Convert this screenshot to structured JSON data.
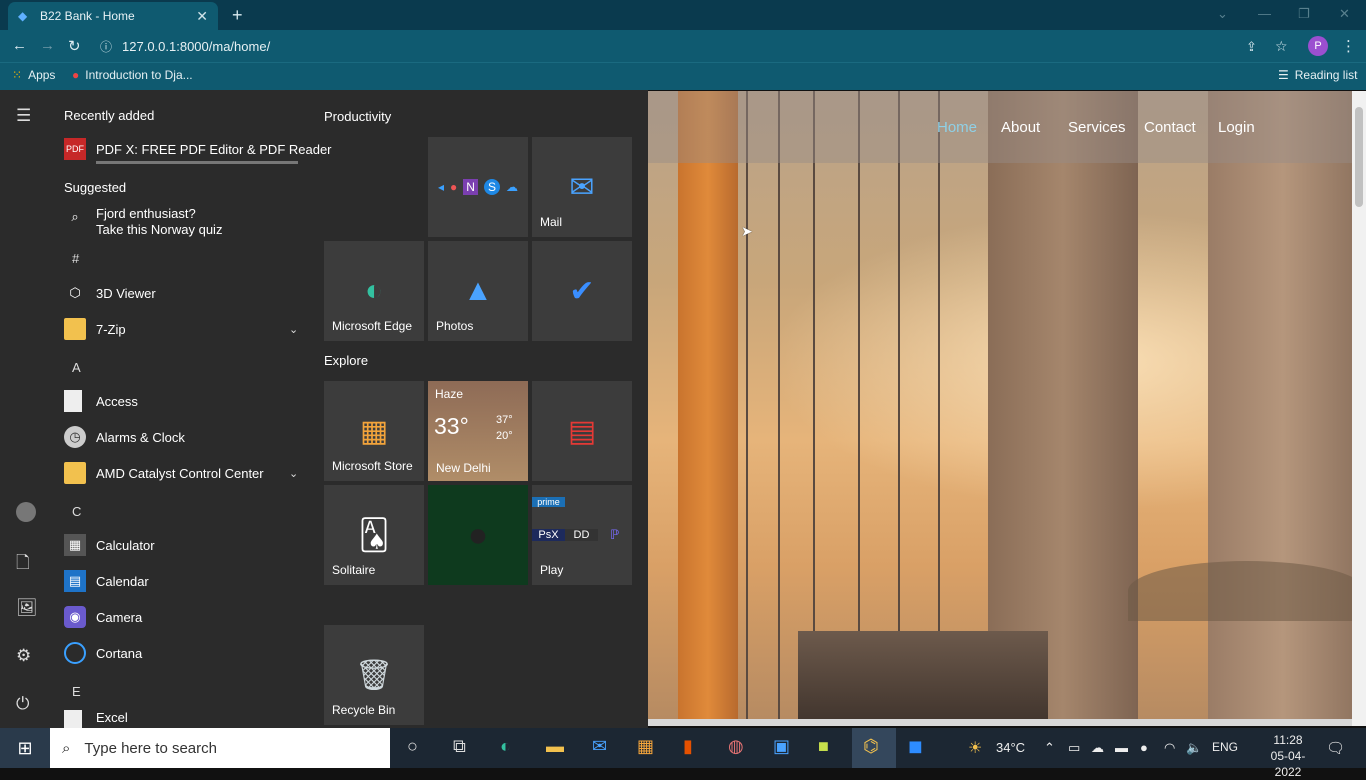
{
  "browser": {
    "tab_title": "B22 Bank - Home",
    "new_tab": "+",
    "url": "127.0.0.1:8000/ma/home/",
    "url_info_icon": "info-icon",
    "profile_initial": "P",
    "bookmarks": [
      {
        "label": "Apps",
        "icon": "apps-grid-icon"
      },
      {
        "label": "Introduction to Dja...",
        "icon": "site-favicon"
      }
    ],
    "reading_list": "Reading list"
  },
  "site": {
    "nav": [
      "Home",
      "About",
      "Services",
      "Contact",
      "Login"
    ],
    "active": "Home"
  },
  "start_menu": {
    "recently_added_heading": "Recently added",
    "recent": [
      {
        "label": "PDF X: FREE PDF Editor & PDF Reader"
      }
    ],
    "suggested_heading": "Suggested",
    "suggested": {
      "line1": "Fjord enthusiast?",
      "line2": "Take this Norway quiz"
    },
    "letters": [
      "#",
      "A",
      "C",
      "E"
    ],
    "apps": [
      {
        "label": "3D Viewer"
      },
      {
        "label": "7-Zip"
      },
      {
        "label": "Access"
      },
      {
        "label": "Alarms & Clock"
      },
      {
        "label": "AMD Catalyst Control Center"
      },
      {
        "label": "Calculator"
      },
      {
        "label": "Calendar"
      },
      {
        "label": "Camera"
      },
      {
        "label": "Cortana"
      },
      {
        "label": "Excel"
      }
    ],
    "groups": [
      "Productivity",
      "Explore"
    ],
    "tiles": {
      "mail": "Mail",
      "edge": "Microsoft Edge",
      "photos": "Photos",
      "store": "Microsoft Store",
      "weather": {
        "condition": "Haze",
        "temp": "33°",
        "high": "37°",
        "low": "20°",
        "city": "New Delhi"
      },
      "solitaire": "Solitaire",
      "play": "Play",
      "recycle": "Recycle Bin"
    }
  },
  "taskbar": {
    "search_placeholder": "Type here to search",
    "weather_temp": "34°C",
    "language": "ENG",
    "time": "11:28",
    "date": "05-04-2022"
  },
  "colors": {
    "chrome_dark": "#0a3a4e",
    "chrome": "#0f5a70",
    "start_bg": "#2b2b2b",
    "tile_bg": "#3c3c3c",
    "active_link": "#8fd0e6",
    "taskbar": "#1c2733"
  }
}
